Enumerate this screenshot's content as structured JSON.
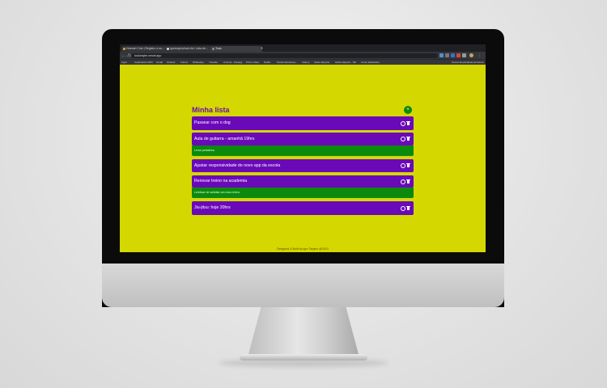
{
  "browser": {
    "tabs": [
      {
        "label": "Hotmart Club | Registro e ac..."
      },
      {
        "label": "igortargino/todo-list: Lista de..."
      },
      {
        "label": "Todo"
      }
    ],
    "new_tab": "+",
    "url": "todoimyter.vercel.app",
    "bookmarks": [
      "Apps",
      "Celebrando VDN",
      "Gmail",
      "Outlook",
      "iCloud",
      "WhatsApp",
      "Youtube",
      "Cinema - Partage",
      "Prime Video",
      "Netflix",
      "Portal Homeboss...",
      "Udemy",
      "Globo Esporte",
      "Globo Esporte - PE",
      "Curso Estatística",
      "Outros favoritos",
      "Lista de leitura"
    ]
  },
  "app": {
    "title": "Minha lista",
    "add_button": "+",
    "tasks": [
      {
        "text": "Passear com o dog"
      },
      {
        "text": "Aula de guitarra - amanhã 19hrs",
        "note": "Levar pedaleira"
      },
      {
        "text": "Ajustar responsividade do novo app da escola"
      },
      {
        "text": "Renovar treino na academia",
        "note": "Lembrar de solicitar um novo treino"
      },
      {
        "text": "Jiu-jitsu: hoje 20hrs"
      }
    ],
    "footer": "Designed & Built by Igor Targino @2021"
  },
  "colors": {
    "background": "#d4d800",
    "task_card": "#6a09b8",
    "note_bar": "#0c8a0c",
    "title": "#6a0dad",
    "add_button": "#0b8a0b"
  }
}
